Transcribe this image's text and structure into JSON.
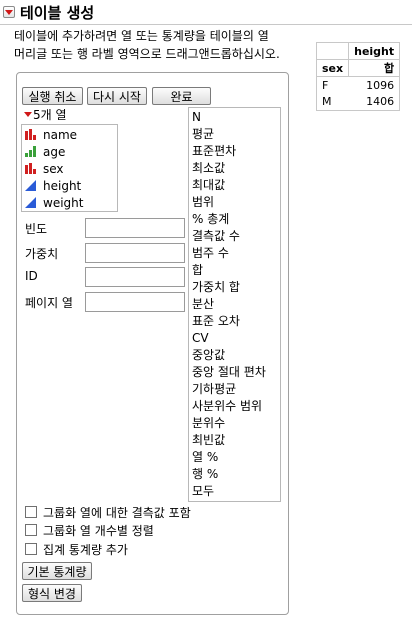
{
  "header": {
    "title": "테이블 생성",
    "instruction_line1": "테이블에 추가하려면 열 또는 통계량을 테이블의 열",
    "instruction_line2": "머리글 또는 행 라벨 영역으로 드래그앤드롭하십시오."
  },
  "result_table": {
    "column_header": "height",
    "row_label_header": "sex",
    "stat_header": "합",
    "rows": [
      {
        "label": "F",
        "value": "1096"
      },
      {
        "label": "M",
        "value": "1406"
      }
    ]
  },
  "toolbar": {
    "cancel_label": "실행 취소",
    "restart_label": "다시 시작",
    "done_label": "완료"
  },
  "columns_panel": {
    "header": "5개 열",
    "items": [
      {
        "label": "name",
        "icon": "nominal-icon"
      },
      {
        "label": "age",
        "icon": "ordinal-icon"
      },
      {
        "label": "sex",
        "icon": "nominal-icon"
      },
      {
        "label": "height",
        "icon": "continuous-icon"
      },
      {
        "label": "weight",
        "icon": "continuous-icon"
      }
    ]
  },
  "roles": {
    "freq": "빈도",
    "weight": "가중치",
    "id": "ID",
    "page": "페이지 열"
  },
  "statistics": [
    "N",
    "평균",
    "표준편차",
    "최소값",
    "최대값",
    "범위",
    "% 총계",
    "결측값 수",
    "범주 수",
    "합",
    "가중치 합",
    "분산",
    "표준 오차",
    "CV",
    "중앙값",
    "중앙 절대 편차",
    "기하평균",
    "사분위수 범위",
    "분위수",
    "최빈값",
    "열 %",
    "행 %",
    "모두"
  ],
  "options": {
    "include_missing": "그룹화 열에 대한 결측값 포함",
    "order_by_count": "그룹화 열 개수별 정렬",
    "add_agg_stats": "집계 통계량 추가"
  },
  "bottom_buttons": {
    "default_stats": "기본 통계량",
    "change_format": "형식 변경"
  },
  "colors": {
    "disclosure_red": "#d01818",
    "nominal_red": "#d02020",
    "ordinal_green": "#3aa03a",
    "continuous_blue": "#2a5bd7"
  }
}
